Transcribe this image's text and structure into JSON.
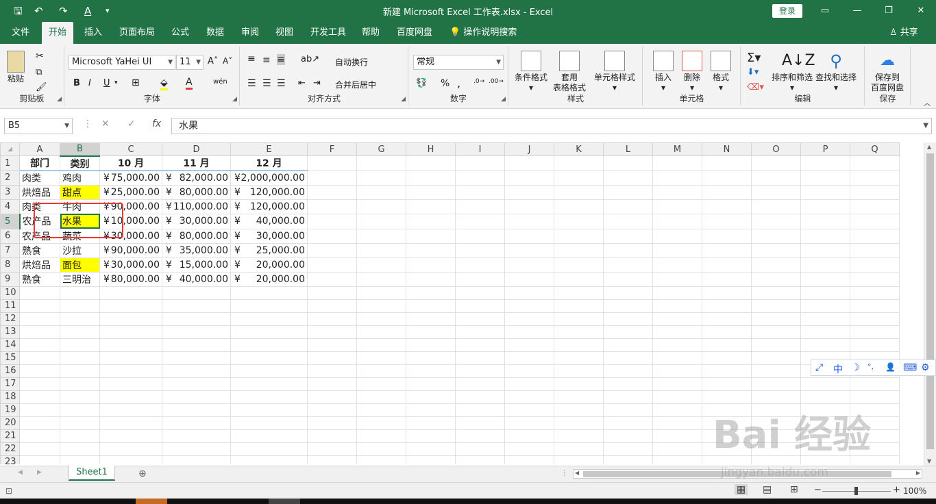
{
  "titlebar": {
    "title": "新建 Microsoft Excel 工作表.xlsx  -  Excel",
    "login": "登录",
    "quick_save": "🖫",
    "quick_undo": "↶",
    "quick_redo": "↷",
    "quick_font": "A",
    "quick_more": "▾",
    "restore_ribbon": "▭",
    "minimize": "—",
    "maximize": "❐",
    "close": "✕"
  },
  "tabs": {
    "items": [
      "文件",
      "开始",
      "插入",
      "页面布局",
      "公式",
      "数据",
      "审阅",
      "视图",
      "开发工具",
      "帮助",
      "百度网盘"
    ],
    "tell_me": "💡 操作说明搜索",
    "share": "♙ 共享"
  },
  "ribbon": {
    "clipboard": {
      "paste": "粘贴",
      "label": "剪贴板"
    },
    "font": {
      "name": "Microsoft YaHei UI",
      "size": "11",
      "grow": "A˄",
      "shrink": "A˅",
      "bold": "B",
      "italic": "I",
      "underline": "U",
      "wen": "wén",
      "label": "字体"
    },
    "alignment": {
      "wrap": "自动换行",
      "merge": "合并后居中",
      "label": "对齐方式"
    },
    "number": {
      "format": "常规",
      "percent": "%",
      "comma": ",",
      "label": "数字"
    },
    "styles": {
      "conditional": "条件格式",
      "table_a": "套用",
      "table_b": "表格格式",
      "cell_styles": "单元格样式",
      "label": "样式"
    },
    "cells": {
      "insert": "插入",
      "delete": "删除",
      "format": "格式",
      "label": "单元格"
    },
    "editing": {
      "sort": "排序和筛选",
      "find": "查找和选择",
      "label": "编辑"
    },
    "save": {
      "save_a": "保存到",
      "save_b": "百度网盘",
      "label": "保存"
    }
  },
  "formula_bar": {
    "name_box": "B5",
    "cancel": "✕",
    "enter": "✓",
    "fx": "fx",
    "content": "水果"
  },
  "sheet": {
    "columns": [
      "A",
      "B",
      "C",
      "D",
      "E",
      "F",
      "G",
      "H",
      "I",
      "J",
      "K",
      "L",
      "M",
      "N",
      "O",
      "P",
      "Q"
    ],
    "rows": [
      [
        "部门",
        "类别",
        "10 月",
        "11 月",
        "12 月"
      ],
      [
        "肉类",
        "鸡肉",
        "75,000.00",
        "82,000.00",
        "2,000,000.00"
      ],
      [
        "烘焙品",
        "甜点",
        "25,000.00",
        "80,000.00",
        "120,000.00"
      ],
      [
        "肉类",
        "牛肉",
        "90,000.00",
        "110,000.00",
        "120,000.00"
      ],
      [
        "农产品",
        "水果",
        "10,000.00",
        "30,000.00",
        "40,000.00"
      ],
      [
        "农产品",
        "蔬菜",
        "30,000.00",
        "80,000.00",
        "30,000.00"
      ],
      [
        "熟食",
        "沙拉",
        "90,000.00",
        "35,000.00",
        "25,000.00"
      ],
      [
        "烘焙品",
        "面包",
        "30,000.00",
        "15,000.00",
        "20,000.00"
      ],
      [
        "熟食",
        "三明治",
        "80,000.00",
        "40,000.00",
        "20,000.00"
      ]
    ],
    "row_numbers": [
      "1",
      "2",
      "3",
      "4",
      "5",
      "6",
      "7",
      "8",
      "9",
      "10",
      "11",
      "12",
      "13",
      "14",
      "15",
      "16",
      "17",
      "18",
      "19",
      "20",
      "21",
      "22",
      "23"
    ],
    "currency_symbol": "¥",
    "highlight_color": "#ffff00",
    "active_cell": "B5"
  },
  "sheet_tabs": {
    "sheet1": "Sheet1",
    "add": "⊕"
  },
  "status": {
    "zoom": "100%"
  },
  "ime": {
    "items": [
      "⤢",
      "中",
      "☽",
      "°,",
      "👤",
      "⌨",
      "⚙"
    ]
  },
  "watermark": {
    "main": "Bai 经验",
    "sub": "jingyan.baidu.com"
  }
}
